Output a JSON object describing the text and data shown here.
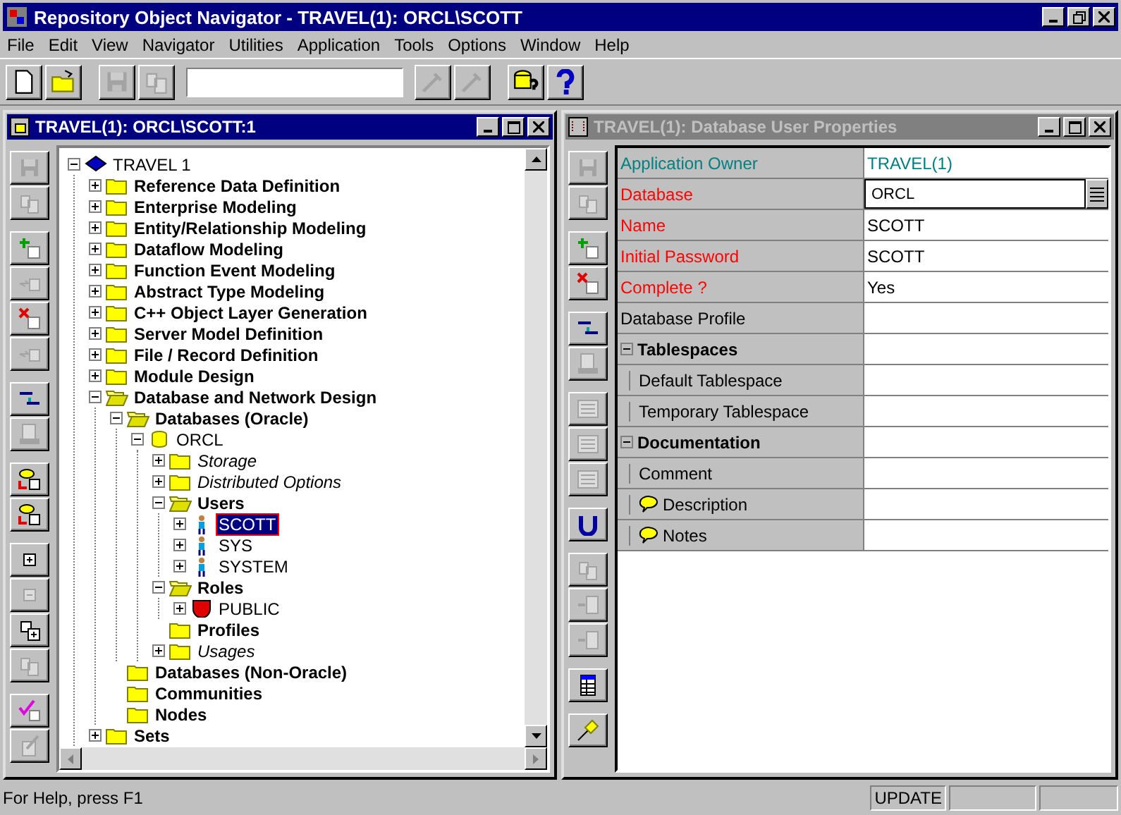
{
  "window": {
    "title": "Repository Object Navigator - TRAVEL(1): ORCL\\SCOTT"
  },
  "menu": [
    "File",
    "Edit",
    "View",
    "Navigator",
    "Utilities",
    "Application",
    "Tools",
    "Options",
    "Window",
    "Help"
  ],
  "toolbar": [
    {
      "disabled": false
    },
    {
      "disabled": false
    },
    {
      "disabled": true
    },
    {
      "disabled": true
    },
    {
      "disabled": true
    },
    {
      "disabled": true
    },
    {
      "disabled": false
    },
    {
      "disabled": false
    }
  ],
  "navigator": {
    "title": "TRAVEL(1): ORCL\\SCOTT:1",
    "active": true,
    "tools": [
      {
        "disabled": true
      },
      {
        "disabled": true
      },
      {
        "disabled": false
      },
      {
        "disabled": true
      },
      {
        "disabled": false
      },
      {
        "disabled": true
      },
      {
        "disabled": false
      },
      {
        "disabled": true
      },
      {
        "disabled": false
      },
      {
        "disabled": false
      },
      {
        "disabled": false
      },
      {
        "disabled": true
      },
      {
        "disabled": false
      },
      {
        "disabled": true
      },
      {
        "disabled": false
      },
      {
        "disabled": true
      }
    ],
    "tree": [
      {
        "label": "TRAVEL 1",
        "kind": "repository",
        "expanded": true,
        "selected": false,
        "children": [
          {
            "label": "Reference Data Definition",
            "kind": "category",
            "expanded": false,
            "selected": false
          },
          {
            "label": "Enterprise Modeling",
            "kind": "category",
            "expanded": false,
            "selected": false
          },
          {
            "label": "Entity/Relationship Modeling",
            "kind": "category",
            "expanded": false,
            "selected": false
          },
          {
            "label": "Dataflow Modeling",
            "kind": "category",
            "expanded": false,
            "selected": false
          },
          {
            "label": "Function Event Modeling",
            "kind": "category",
            "expanded": false,
            "selected": false
          },
          {
            "label": "Abstract Type Modeling",
            "kind": "category",
            "expanded": false,
            "selected": false
          },
          {
            "label": "C++ Object Layer Generation",
            "kind": "category",
            "expanded": false,
            "selected": false
          },
          {
            "label": "Server Model Definition",
            "kind": "category",
            "expanded": false,
            "selected": false
          },
          {
            "label": "File / Record Definition",
            "kind": "category",
            "expanded": false,
            "selected": false
          },
          {
            "label": "Module Design",
            "kind": "category",
            "expanded": false,
            "selected": false
          },
          {
            "label": "Database and Network Design",
            "kind": "category",
            "expanded": true,
            "selected": false,
            "children": [
              {
                "label": "Databases (Oracle)",
                "kind": "category",
                "expanded": true,
                "selected": false,
                "children": [
                  {
                    "label": "ORCL",
                    "kind": "database",
                    "expanded": true,
                    "selected": false,
                    "children": [
                      {
                        "label": "Storage",
                        "kind": "optional-category",
                        "expanded": false,
                        "selected": false
                      },
                      {
                        "label": "Distributed Options",
                        "kind": "optional-category",
                        "expanded": false,
                        "selected": false
                      },
                      {
                        "label": "Users",
                        "kind": "category",
                        "expanded": true,
                        "selected": false,
                        "children": [
                          {
                            "label": "SCOTT",
                            "kind": "user",
                            "expanded": false,
                            "selected": true
                          },
                          {
                            "label": "SYS",
                            "kind": "user",
                            "expanded": false,
                            "selected": false
                          },
                          {
                            "label": "SYSTEM",
                            "kind": "user",
                            "expanded": false,
                            "selected": false
                          }
                        ]
                      },
                      {
                        "label": "Roles",
                        "kind": "category",
                        "expanded": true,
                        "selected": false,
                        "children": [
                          {
                            "label": "PUBLIC",
                            "kind": "role",
                            "expanded": false,
                            "selected": false
                          }
                        ]
                      },
                      {
                        "label": "Profiles",
                        "kind": "category",
                        "selected": false
                      },
                      {
                        "label": "Usages",
                        "kind": "optional-category",
                        "expanded": false,
                        "selected": false
                      }
                    ]
                  }
                ]
              },
              {
                "label": "Databases (Non-Oracle)",
                "kind": "category",
                "selected": false
              },
              {
                "label": "Communities",
                "kind": "category",
                "selected": false
              },
              {
                "label": "Nodes",
                "kind": "category",
                "selected": false
              }
            ]
          },
          {
            "label": "Sets",
            "kind": "category",
            "expanded": false,
            "selected": false
          }
        ]
      }
    ]
  },
  "properties": {
    "title": "TRAVEL(1): Database User Properties",
    "active": false,
    "tools": [
      {
        "disabled": true
      },
      {
        "disabled": true
      },
      {
        "disabled": false
      },
      {
        "disabled": false
      },
      {
        "disabled": false
      },
      {
        "disabled": true
      },
      {
        "disabled": true
      },
      {
        "disabled": true
      },
      {
        "disabled": true
      },
      {
        "disabled": false
      },
      {
        "disabled": true
      },
      {
        "disabled": true
      },
      {
        "disabled": true
      },
      {
        "disabled": false
      },
      {
        "disabled": false
      }
    ],
    "rows": [
      {
        "kind": "readonly",
        "label": "Application Owner",
        "color": "#008080",
        "value": "TRAVEL(1)"
      },
      {
        "kind": "list",
        "label": "Database",
        "color": "#ff0000",
        "value": "ORCL"
      },
      {
        "kind": "text",
        "label": "Name",
        "color": "#ff0000",
        "value": "SCOTT"
      },
      {
        "kind": "text",
        "label": "Initial Password",
        "color": "#ff0000",
        "value": "SCOTT"
      },
      {
        "kind": "text",
        "label": "Complete ?",
        "color": "#ff0000",
        "value": "Yes"
      },
      {
        "kind": "text",
        "label": "Database Profile",
        "color": "#000000"
      },
      {
        "kind": "group",
        "label": "Tablespaces",
        "expanded": true,
        "children": [
          {
            "kind": "text",
            "label": "Default Tablespace"
          },
          {
            "kind": "text",
            "label": "Temporary Tablespace"
          }
        ]
      },
      {
        "kind": "group",
        "label": "Documentation",
        "expanded": true,
        "children": [
          {
            "kind": "text",
            "label": "Comment"
          },
          {
            "kind": "note",
            "label": "Description"
          },
          {
            "kind": "note",
            "label": "Notes"
          }
        ]
      }
    ]
  },
  "status_bar": {
    "help": "For Help, press F1",
    "mode": "UPDATE"
  }
}
